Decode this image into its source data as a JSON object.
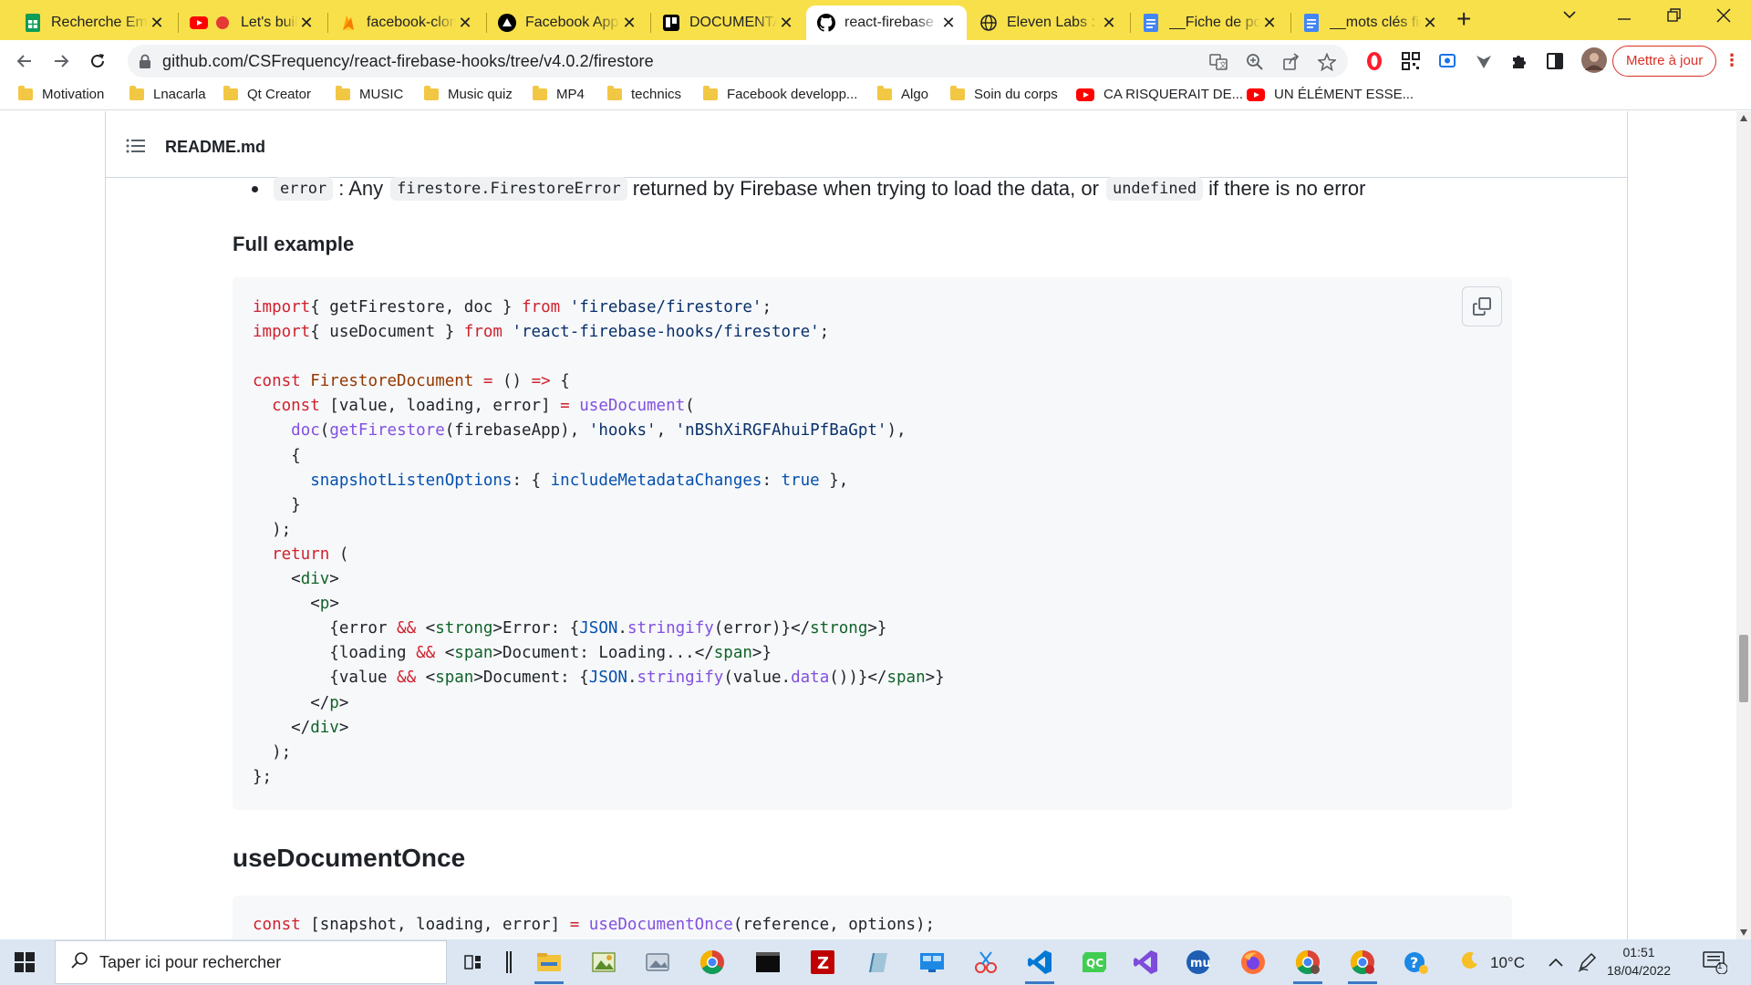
{
  "tabs": [
    {
      "title": "Recherche Em",
      "icon": "sheets-icon"
    },
    {
      "title": "Let's build",
      "icon": "youtube-icon"
    },
    {
      "title": "facebook-clon",
      "icon": "firebase-icon"
    },
    {
      "title": "Facebook App",
      "icon": "vercel-icon"
    },
    {
      "title": "DOCUMENTAT",
      "icon": "trello-icon"
    },
    {
      "title": "react-firebase",
      "icon": "github-icon"
    },
    {
      "title": "Eleven Labs : A",
      "icon": "globe-icon"
    },
    {
      "title": "__Fiche de po",
      "icon": "docs-icon"
    },
    {
      "title": "__mots clés fic",
      "icon": "docs-icon"
    }
  ],
  "url": "github.com/CSFrequency/react-firebase-hooks/tree/v4.0.2/firestore",
  "update_label": "Mettre à jour",
  "bookmarks": [
    {
      "label": "Motivation",
      "type": "folder"
    },
    {
      "label": "Lnacarla",
      "type": "folder"
    },
    {
      "label": "Qt Creator",
      "type": "folder"
    },
    {
      "label": "MUSIC",
      "type": "folder"
    },
    {
      "label": "Music quiz",
      "type": "folder"
    },
    {
      "label": "MP4",
      "type": "folder"
    },
    {
      "label": "technics",
      "type": "folder"
    },
    {
      "label": "Facebook developp...",
      "type": "folder"
    },
    {
      "label": "Algo",
      "type": "folder"
    },
    {
      "label": "Soin du corps",
      "type": "folder"
    },
    {
      "label": "CA RISQUERAIT DE...",
      "type": "youtube"
    },
    {
      "label": "UN ÉLÉMENT ESSE...",
      "type": "youtube"
    }
  ],
  "readme": {
    "filename": "README.md",
    "error_line": {
      "code_error": "error",
      "text1": ": Any",
      "code_firestore_error": "firestore.FirestoreError",
      "text2": "returned by Firebase when trying to load the data, or",
      "code_undefined": "undefined",
      "text3": "if there is no error"
    },
    "full_example_heading": "Full example",
    "code_block_1": {
      "lines": [
        [
          [
            "k",
            "import"
          ],
          [
            "",
            "{ getFirestore, doc } "
          ],
          [
            "k",
            "from"
          ],
          [
            "",
            ""
          ],
          [
            "s",
            " 'firebase/firestore'"
          ],
          [
            "",
            ";"
          ]
        ],
        [
          [
            "k",
            "import"
          ],
          [
            "",
            "{ useDocument } "
          ],
          [
            "k",
            "from"
          ],
          [
            "s",
            " 'react-firebase-hooks/firestore'"
          ],
          [
            "",
            ";"
          ]
        ],
        [],
        [
          [
            "k",
            "const"
          ],
          [
            "",
            ""
          ],
          [
            "c",
            " FirestoreDocument"
          ],
          [
            "k",
            " ="
          ],
          [
            "",
            " () "
          ],
          [
            "k",
            "=>"
          ],
          [
            "",
            " {"
          ]
        ],
        [
          [
            "",
            "  "
          ],
          [
            "k",
            "const"
          ],
          [
            "",
            " [value, loading, error] "
          ],
          [
            "k",
            "="
          ],
          [
            "f",
            " useDocument"
          ],
          [
            "",
            "("
          ]
        ],
        [
          [
            "",
            "    "
          ],
          [
            "f",
            "doc"
          ],
          [
            "",
            "("
          ],
          [
            "f",
            "getFirestore"
          ],
          [
            "",
            "(firebaseApp), "
          ],
          [
            "s",
            "'hooks'"
          ],
          [
            "",
            ", "
          ],
          [
            "s",
            "'nBShXiRGFAhuiPfBaGpt'"
          ],
          [
            "",
            "),"
          ]
        ],
        [
          [
            "",
            "    {"
          ]
        ],
        [
          [
            "",
            "      "
          ],
          [
            "p",
            "snapshotListenOptions"
          ],
          [
            "",
            ": { "
          ],
          [
            "p",
            "includeMetadataChanges"
          ],
          [
            "",
            ": "
          ],
          [
            "p",
            "true"
          ],
          [
            "",
            " },"
          ]
        ],
        [
          [
            "",
            "    }"
          ]
        ],
        [
          [
            "",
            "  );"
          ]
        ],
        [
          [
            "",
            "  "
          ],
          [
            "k",
            "return"
          ],
          [
            "",
            " ("
          ]
        ],
        [
          [
            "",
            "    <"
          ],
          [
            "t",
            "div"
          ],
          [
            "",
            ">"
          ]
        ],
        [
          [
            "",
            "      <"
          ],
          [
            "t",
            "p"
          ],
          [
            "",
            ">"
          ]
        ],
        [
          [
            "",
            "        {error "
          ],
          [
            "k",
            "&&"
          ],
          [
            "",
            " <"
          ],
          [
            "t",
            "strong"
          ],
          [
            "",
            ">Error: {"
          ],
          [
            "p",
            "JSON"
          ],
          [
            "",
            "."
          ],
          [
            "f",
            "stringify"
          ],
          [
            "",
            "(error)}</"
          ],
          [
            "t",
            "strong"
          ],
          [
            "",
            ">}"
          ]
        ],
        [
          [
            "",
            "        {loading "
          ],
          [
            "k",
            "&&"
          ],
          [
            "",
            " <"
          ],
          [
            "t",
            "span"
          ],
          [
            "",
            ">Document: Loading...</"
          ],
          [
            "t",
            "span"
          ],
          [
            "",
            ">}"
          ]
        ],
        [
          [
            "",
            "        {value "
          ],
          [
            "k",
            "&&"
          ],
          [
            "",
            " <"
          ],
          [
            "t",
            "span"
          ],
          [
            "",
            ">Document: {"
          ],
          [
            "p",
            "JSON"
          ],
          [
            "",
            "."
          ],
          [
            "f",
            "stringify"
          ],
          [
            "",
            "(value."
          ],
          [
            "f",
            "data"
          ],
          [
            "",
            "())}</"
          ],
          [
            "t",
            "span"
          ],
          [
            "",
            ">}"
          ]
        ],
        [
          [
            "",
            "      </"
          ],
          [
            "t",
            "p"
          ],
          [
            "",
            ">"
          ]
        ],
        [
          [
            "",
            "    </"
          ],
          [
            "t",
            "div"
          ],
          [
            "",
            ">"
          ]
        ],
        [
          [
            "",
            "  );"
          ]
        ],
        [
          [
            "",
            "};"
          ]
        ]
      ]
    },
    "use_document_once_heading": "useDocumentOnce",
    "code_block_2": {
      "lines": [
        [
          [
            "k",
            "const"
          ],
          [
            "",
            " [snapshot, loading, error] "
          ],
          [
            "k",
            "="
          ],
          [
            "f",
            " useDocumentOnce"
          ],
          [
            "",
            "(reference, options);"
          ]
        ]
      ]
    }
  },
  "taskbar": {
    "search_placeholder": "Taper ici pour rechercher",
    "weather_temp": "10°C",
    "time": "01:51",
    "date": "18/04/2022",
    "notification_count": "1"
  }
}
